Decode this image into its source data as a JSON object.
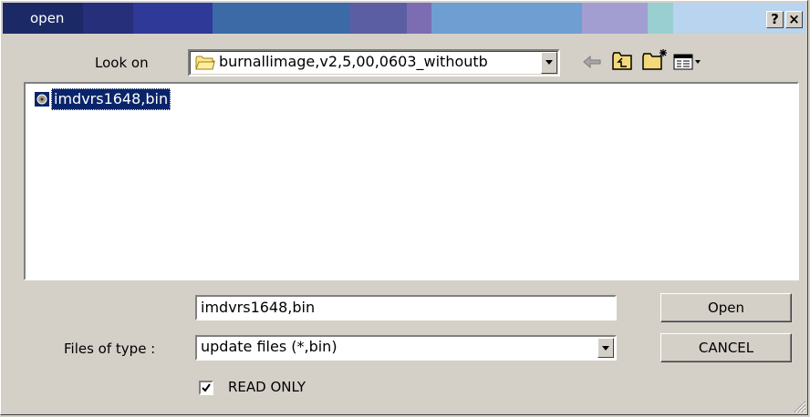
{
  "window": {
    "title": "open",
    "help_button": "?",
    "close_button": "×"
  },
  "look_on": {
    "label": "Look on",
    "value": "burnallimage,v2,5,00,0603_withoutb"
  },
  "file_list": {
    "items": [
      {
        "name": "imdvrs1648,bin",
        "icon": "file-icon"
      }
    ]
  },
  "file_name": {
    "value": "imdvrs1648,bin"
  },
  "files_of_type": {
    "label": "Files of type :",
    "value": "update files (*,bin)"
  },
  "buttons": {
    "open": "Open",
    "cancel": "CANCEL"
  },
  "read_only": {
    "label": "READ ONLY",
    "checked": true
  },
  "toolbar_icons": [
    "back-arrow-icon",
    "up-folder-icon",
    "new-folder-icon",
    "view-menu-icon"
  ],
  "colors": {
    "selection": "#0a246a",
    "dialog_bg": "#d4d0c8"
  }
}
